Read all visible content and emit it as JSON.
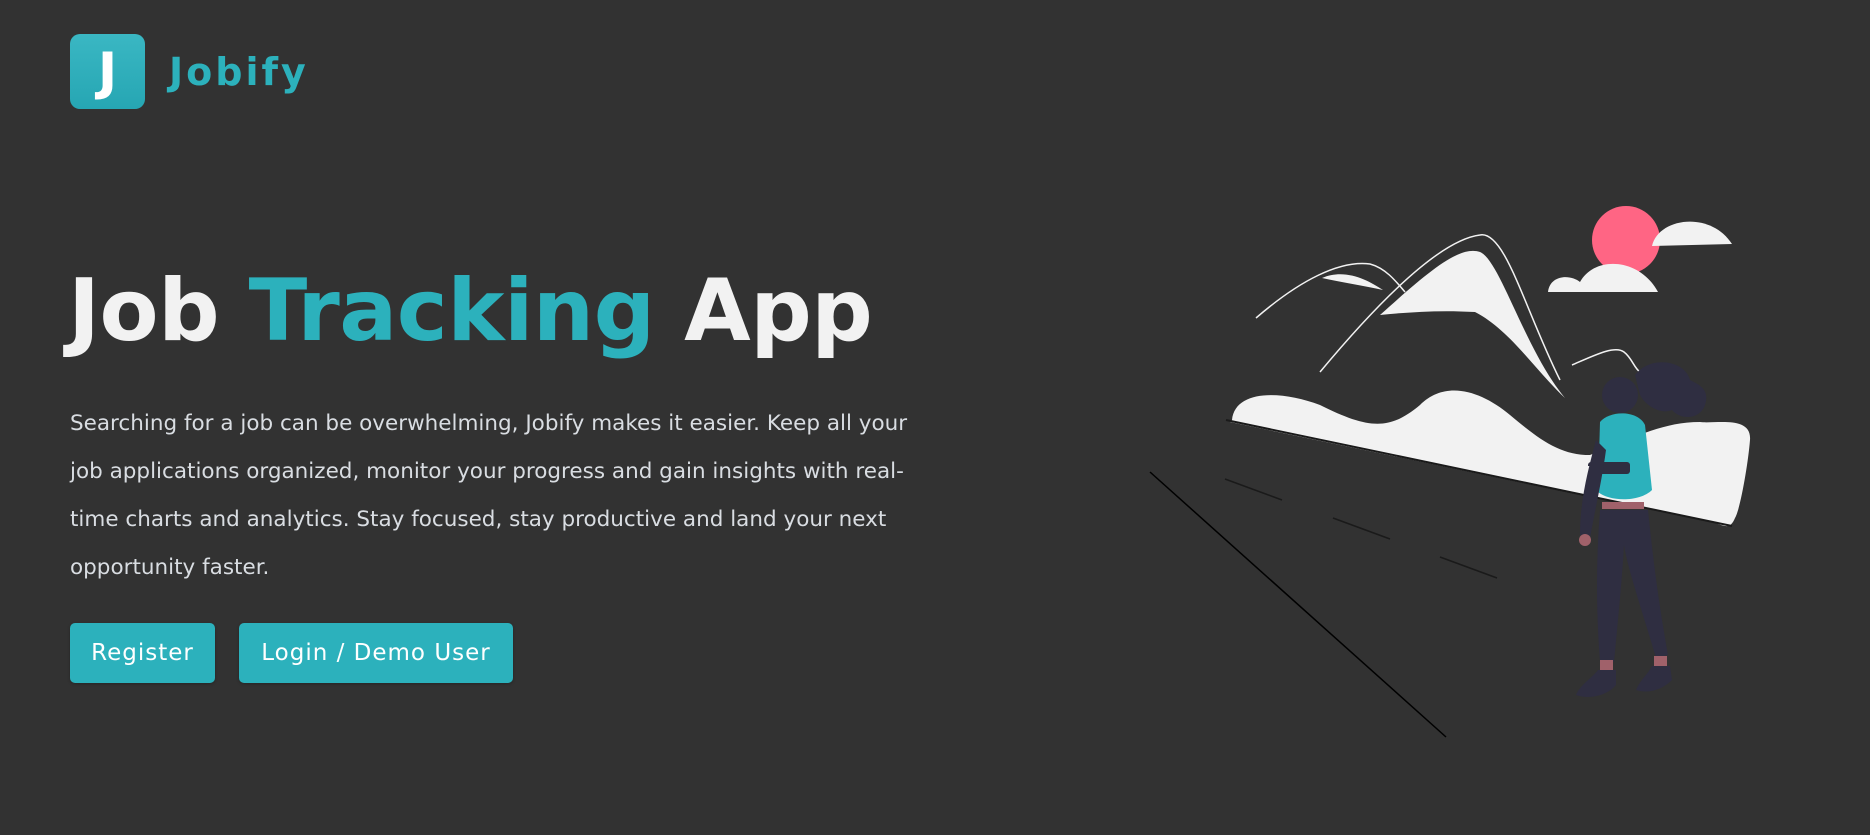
{
  "nav": {
    "logo_letter": "J",
    "brand_name": "Jobify"
  },
  "hero": {
    "title_part1": "Job",
    "title_accent": "Tracking",
    "title_part2": "App",
    "description": "Searching for a job can be overwhelming, Jobify makes it easier. Keep all your job applications organized, monitor your progress and gain insights with real-time charts and analytics. Stay focused, stay productive and land your next opportunity faster.",
    "register_label": "Register",
    "login_label": "Login / Demo User"
  },
  "colors": {
    "background": "#323232",
    "accent": "#2cb1bc",
    "sun": "#ff6584",
    "figure": "#2f2e41"
  },
  "illustration": {
    "icon": "hiker-mountains-illustration"
  }
}
